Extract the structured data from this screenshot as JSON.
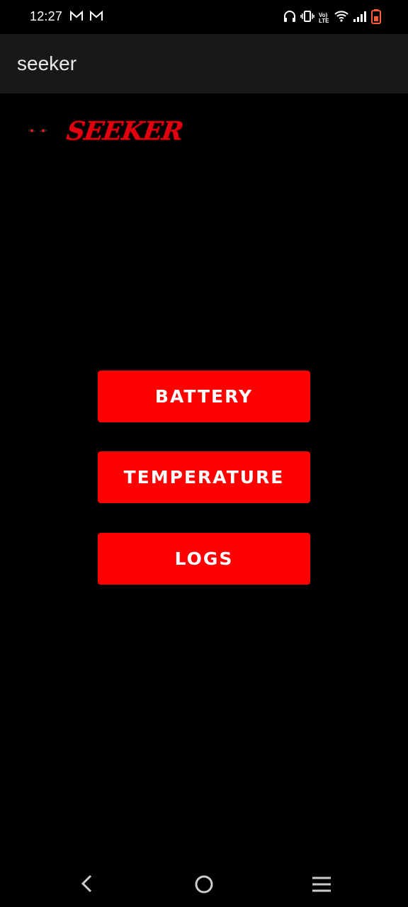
{
  "status_bar": {
    "time": "12:27",
    "left_icons": [
      "gmail-icon",
      "gmail-icon"
    ],
    "right_icons": [
      "headphones-icon",
      "vibrate-icon",
      "volte-icon",
      "wifi-icon",
      "signal-icon",
      "battery-low-icon"
    ],
    "volte_label": "Vo) LTE"
  },
  "app_bar": {
    "title": "seeker"
  },
  "logo": {
    "text": "SEEKER",
    "icon": "eyes-icon"
  },
  "buttons": {
    "battery": "BATTERY",
    "temperature": "TEMPERATURE",
    "logs": "LOGS"
  },
  "nav_bar": {
    "icons": [
      "back-icon",
      "home-icon",
      "menu-icon"
    ]
  },
  "colors": {
    "accent": "#ff0000",
    "background": "#000000",
    "app_bar": "#181818"
  }
}
